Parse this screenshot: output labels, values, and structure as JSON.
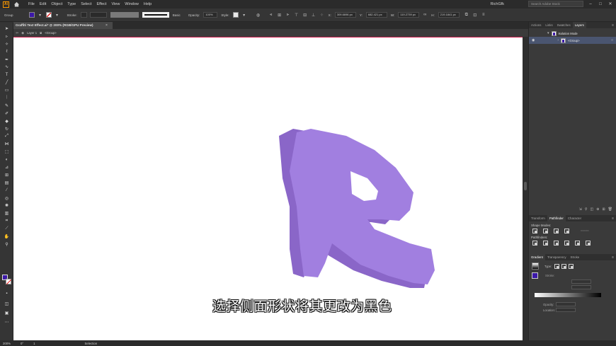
{
  "menubar": {
    "logo": "Ai",
    "items": [
      "File",
      "Edit",
      "Object",
      "Type",
      "Select",
      "Effect",
      "View",
      "Window",
      "Help"
    ],
    "user": "RichGfk",
    "stock_search_placeholder": "Search Adobe Stock",
    "win_minimize": "–",
    "win_maximize": "□",
    "win_close": "✕"
  },
  "controlbar": {
    "selection_type": "Group",
    "stroke_label": "Stroke:",
    "stroke_profile": "Basic",
    "opacity_label": "Opacity:",
    "opacity_value": "100%",
    "style_label": "Style:",
    "x_label": "X:",
    "x_value": "309.6696 px",
    "y_label": "Y:",
    "y_value": "682.421 px",
    "w_label": "W:",
    "w_value": "119.2739 px",
    "h_label": "H:",
    "h_value": "219.1841 px",
    "fill_color": "#3c18a8"
  },
  "document": {
    "tab_title": "Graffiti Text Effect.ai* @ 200% (RGB/GPU Preview)",
    "tab_close": "×",
    "breadcrumb_layer": "Layer 1",
    "breadcrumb_group": "<Group>"
  },
  "canvas": {
    "subtitle": "选择侧面形状将其更改为黑色",
    "selected_letter_color": "#3c0f9e",
    "selected_letter_dark": "#27087a",
    "other_letters_color": "#a17fe0",
    "other_letters_shadow": "#8a66c8",
    "selection_color": "#d14a8a"
  },
  "statusbar": {
    "zoom": "200%",
    "rotation": "0°",
    "artboard": "1",
    "tool": "Selection"
  },
  "panels": {
    "top_tabs": [
      "Actions",
      "Links",
      "Swatches",
      "Layers"
    ],
    "isolation_mode_label": "Isolation Mode",
    "group_label": "<Group>",
    "mid_tabs": [
      "Transform",
      "Pathfinder",
      "Character"
    ],
    "shape_modes_label": "Shape Modes:",
    "pathfinders_label": "Pathfinders:",
    "bottom_tabs": [
      "Gradient",
      "Transparency",
      "Stroke"
    ],
    "type_label": "Type:",
    "stroke_label": "Stroke:",
    "opacity_label": "Opacity:",
    "location_label": "Location:"
  }
}
